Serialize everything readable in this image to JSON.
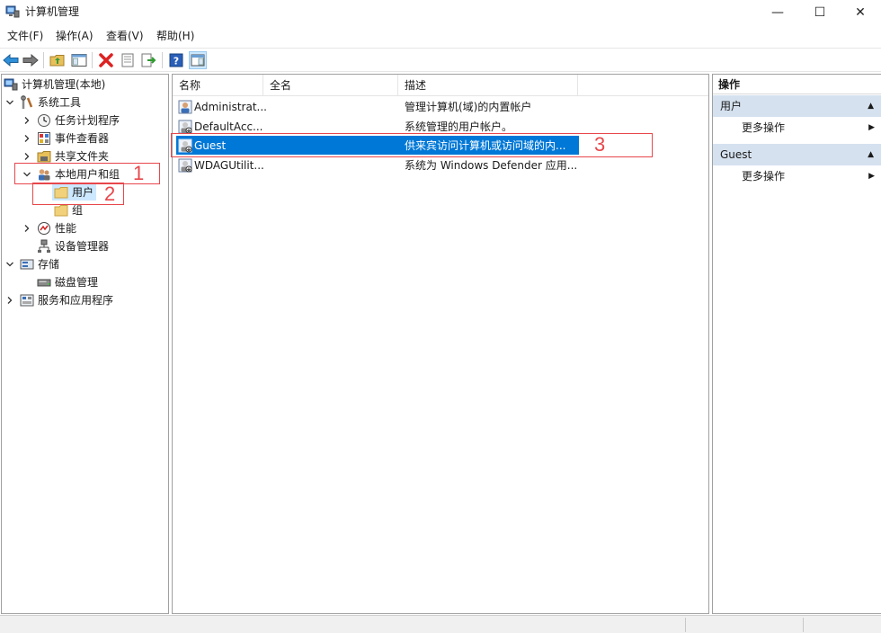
{
  "window": {
    "title": "计算机管理",
    "controls": {
      "minimize": "—",
      "maximize": "☐",
      "close": "✕"
    }
  },
  "menu": {
    "file": "文件(F)",
    "action": "操作(A)",
    "view": "查看(V)",
    "help": "帮助(H)"
  },
  "toolbar": {
    "buttons": [
      "back-icon",
      "forward-icon",
      "up-folder-icon",
      "show-hide-tree-icon",
      "delete-icon",
      "properties-icon",
      "export-icon",
      "help-icon",
      "show-action-pane-icon"
    ]
  },
  "tree": {
    "root": "计算机管理(本地)",
    "system_tools": "系统工具",
    "task_scheduler": "任务计划程序",
    "event_viewer": "事件查看器",
    "shared_folders": "共享文件夹",
    "local_users_groups": "本地用户和组",
    "users": "用户",
    "groups": "组",
    "performance": "性能",
    "device_manager": "设备管理器",
    "storage": "存储",
    "disk_management": "磁盘管理",
    "services_apps": "服务和应用程序"
  },
  "list": {
    "columns": {
      "name": "名称",
      "fullname": "全名",
      "description": "描述"
    },
    "rows": [
      {
        "name": "Administrat...",
        "description": "管理计算机(域)的内置帐户"
      },
      {
        "name": "DefaultAcc...",
        "description": "系统管理的用户帐户。"
      },
      {
        "name": "Guest",
        "description": "供来宾访问计算机或访问域的内..."
      },
      {
        "name": "WDAGUtilit...",
        "description": "系统为 Windows Defender 应用..."
      }
    ]
  },
  "actions": {
    "header": "操作",
    "section1": "用户",
    "more1": "更多操作",
    "section2": "Guest",
    "more2": "更多操作"
  },
  "annotations": {
    "one": "1",
    "two": "2",
    "three": "3"
  },
  "colors": {
    "selection": "#0078d7",
    "annotation": "#e8474b",
    "action_section": "#d5e1ef",
    "tree_selection": "#cce8ff"
  }
}
